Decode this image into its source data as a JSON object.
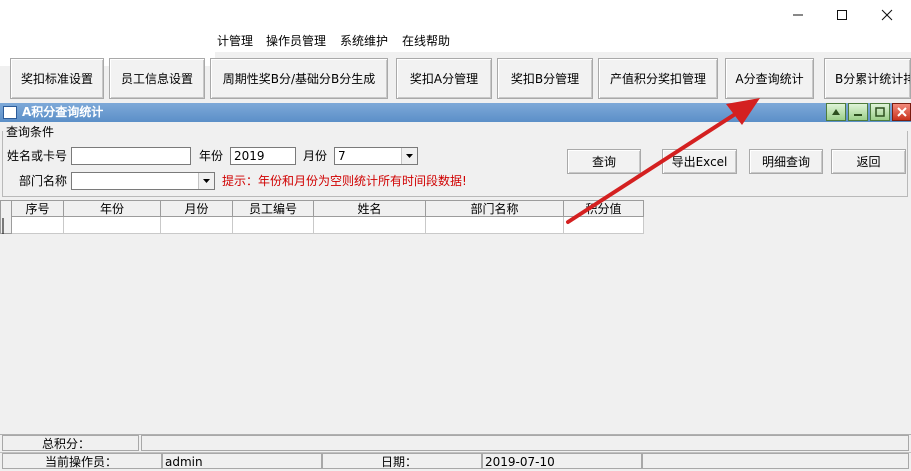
{
  "menu": {
    "items": [
      {
        "label": "计管理"
      },
      {
        "label": "操作员管理"
      },
      {
        "label": "系统维护"
      },
      {
        "label": "在线帮助"
      }
    ]
  },
  "toolbar": {
    "buttons": [
      {
        "label": "奖扣标准设置"
      },
      {
        "label": "员工信息设置"
      },
      {
        "label": "周期性奖B分/基础分B分生成"
      },
      {
        "label": "奖扣A分管理"
      },
      {
        "label": "奖扣B分管理"
      },
      {
        "label": "产值积分奖扣管理"
      },
      {
        "label": "A分查询统计"
      },
      {
        "label": "B分累计统计排"
      }
    ]
  },
  "child_window": {
    "title": "A积分查询统计"
  },
  "query": {
    "group_label": "查询条件",
    "name_label": "姓名或卡号",
    "name_value": "",
    "year_label": "年份",
    "year_value": "2019",
    "month_label": "月份",
    "month_value": "7",
    "dept_label": "部门名称",
    "dept_value": "",
    "hint": "提示：年份和月份为空则统计所有时间段数据!",
    "buttons": {
      "search": "查询",
      "export": "导出Excel",
      "detail": "明细查询",
      "back": "返回"
    }
  },
  "table": {
    "columns": [
      "序号",
      "年份",
      "月份",
      "员工编号",
      "姓名",
      "部门名称",
      "积分值"
    ],
    "rows": [
      [
        "",
        "",
        "",
        "",
        "",
        "",
        ""
      ]
    ]
  },
  "summary": {
    "total_label": "总积分：",
    "total_value": ""
  },
  "status": {
    "operator_label": "当前操作员：",
    "operator_value": "admin",
    "date_label": "日期：",
    "date_value": "2019-07-10"
  },
  "colors": {
    "annotation_arrow": "#d42020",
    "hint": "#d00000"
  }
}
